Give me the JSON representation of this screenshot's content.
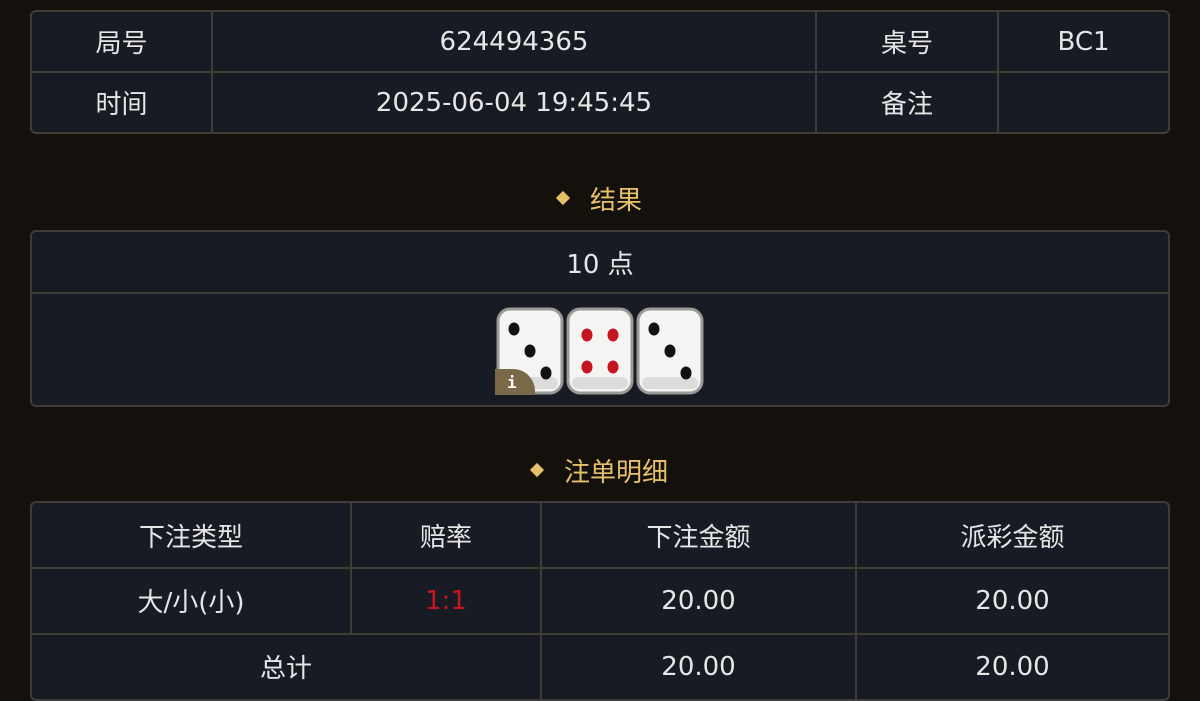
{
  "info": {
    "round_label": "局号",
    "round_value": "624494365",
    "table_label": "桌号",
    "table_value": "BC1",
    "time_label": "时间",
    "time_value": "2025-06-04 19:45:45",
    "note_label": "备注",
    "note_value": ""
  },
  "result": {
    "title": "结果",
    "points": "10 点",
    "dice": [
      {
        "value": 3,
        "pip_color": "#111111"
      },
      {
        "value": 4,
        "pip_color": "#c4141e"
      },
      {
        "value": 3,
        "pip_color": "#111111"
      }
    ],
    "info_badge": "i"
  },
  "details": {
    "title": "注单明细",
    "headers": [
      "下注类型",
      "赔率",
      "下注金额",
      "派彩金额"
    ],
    "rows": [
      {
        "type": "大/小(小)",
        "odds": "1:1",
        "bet": "20.00",
        "payout": "20.00"
      }
    ],
    "total": {
      "label": "总计",
      "bet": "20.00",
      "payout": "20.00"
    }
  },
  "colors": {
    "background": "#14110d",
    "panel": "#181b23",
    "border": "#3f3d38",
    "accent_gold": "#e5c06a",
    "odds_red": "#c8141e"
  }
}
